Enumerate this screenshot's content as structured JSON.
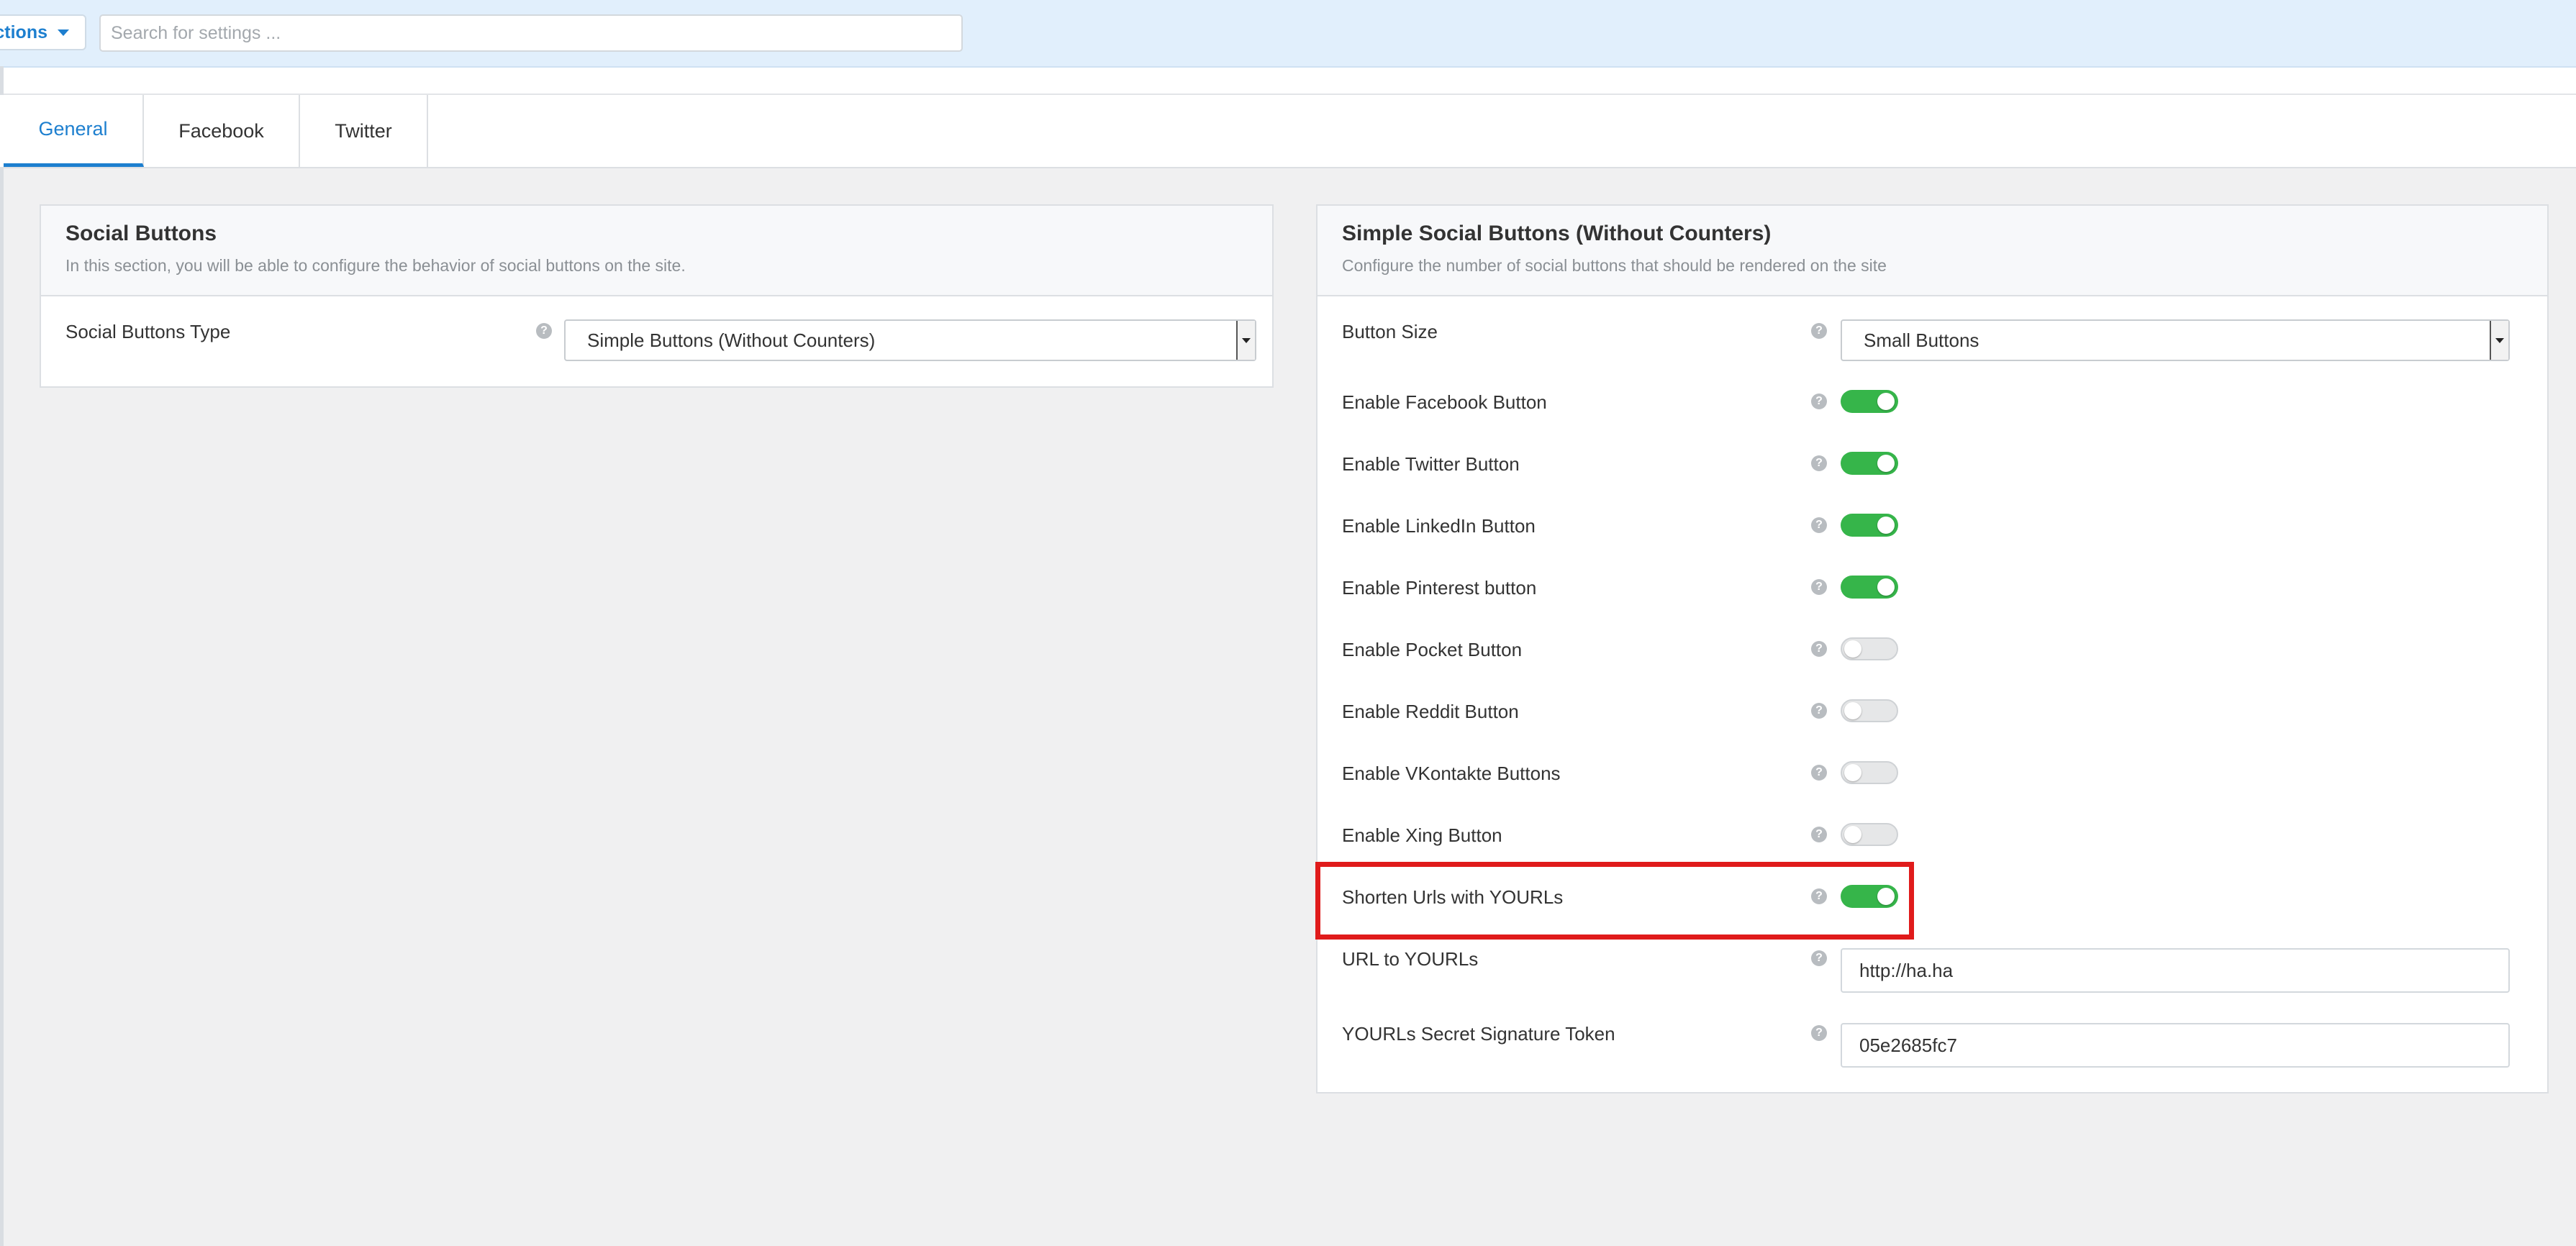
{
  "topbar": {
    "sections_label": "ctions",
    "search_placeholder": "Search for settings ...",
    "accent": "#1d7fcf"
  },
  "tabs": [
    {
      "label": "General",
      "active": true
    },
    {
      "label": "Facebook",
      "active": false
    },
    {
      "label": "Twitter",
      "active": false
    }
  ],
  "social_buttons": {
    "title": "Social Buttons",
    "description": "In this section, you will be able to configure the behavior of social buttons on the site.",
    "type_label": "Social Buttons Type",
    "type_value": "Simple Buttons (Without Counters)"
  },
  "simple_buttons": {
    "title": "Simple Social Buttons (Without Counters)",
    "description": "Configure the number of social buttons that should be rendered on the site",
    "size_label": "Button Size",
    "size_value": "Small Buttons",
    "toggles": [
      {
        "label": "Enable Facebook Button",
        "on": true
      },
      {
        "label": "Enable Twitter Button",
        "on": true
      },
      {
        "label": "Enable LinkedIn Button",
        "on": true
      },
      {
        "label": "Enable Pinterest button",
        "on": true
      },
      {
        "label": "Enable Pocket Button",
        "on": false
      },
      {
        "label": "Enable Reddit Button",
        "on": false
      },
      {
        "label": "Enable VKontakte Buttons",
        "on": false
      },
      {
        "label": "Enable Xing Button",
        "on": false
      },
      {
        "label": "Shorten Urls with YOURLs",
        "on": true
      }
    ],
    "yourls_url_label": "URL to YOURLs",
    "yourls_url_value": "http://ha.ha",
    "yourls_token_label": "YOURLs Secret Signature Token",
    "yourls_token_value": "05e2685fc7"
  },
  "colors": {
    "toggle_on": "#36b54a",
    "highlight": "#e01b1b"
  }
}
